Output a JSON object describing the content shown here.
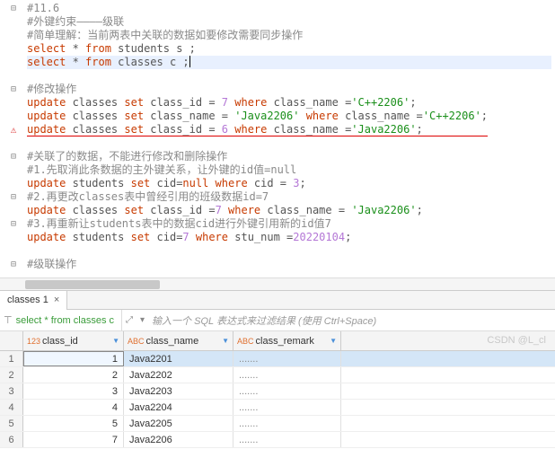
{
  "chart_data": {
    "type": "table",
    "title": "classes",
    "columns": [
      "class_id",
      "class_name",
      "class_remark"
    ],
    "rows": [
      [
        1,
        "Java2201",
        "......."
      ],
      [
        2,
        "Java2202",
        "......."
      ],
      [
        3,
        "Java2203",
        "......."
      ],
      [
        4,
        "Java2204",
        "......."
      ],
      [
        5,
        "Java2205",
        "......."
      ],
      [
        7,
        "Java2206",
        "......."
      ]
    ]
  },
  "code": {
    "l1": "#11.6",
    "l2": "#外键约束————级联",
    "l3": "#简单理解：当前两表中关联的数据如要修改需要同步操作",
    "l4a": "select",
    "l4b": " * ",
    "l4c": "from",
    "l4d": " students s ;",
    "l5a": "select",
    "l5b": " * ",
    "l5c": "from",
    "l5d": " classes c ;",
    "l7": "#修改操作",
    "l8a": "update",
    "l8b": " classes ",
    "l8c": "set",
    "l8d": " class_id = ",
    "l8e": "7",
    "l8f": " where",
    "l8g": " class_name =",
    "l8h": "'C++2206'",
    "l8i": ";",
    "l9a": "update",
    "l9b": " classes ",
    "l9c": "set",
    "l9d": " class_name = ",
    "l9e": "'Java2206'",
    "l9f": " where",
    "l9g": " class_name =",
    "l9h": "'C++2206'",
    "l9i": ";",
    "l10a": "update",
    "l10b": " classes ",
    "l10c": "set",
    "l10d": " class_id = ",
    "l10e": "6",
    "l10f": " where",
    "l10g": " class_name =",
    "l10h": "'Java2206'",
    "l10i": ";",
    "l12": "#关联了的数据，不能进行修改和删除操作",
    "l13": "#1.先取消此条数据的主外键关系，让外键的id值=null",
    "l14a": "update",
    "l14b": " students ",
    "l14c": "set",
    "l14d": " cid=",
    "l14e": "null",
    "l14f": " where",
    "l14g": " cid = ",
    "l14h": "3",
    "l14i": ";",
    "l15": "#2.再更改classes表中曾经引用的班级数据id=7",
    "l16a": "update",
    "l16b": " classes ",
    "l16c": "set",
    "l16d": " class_id =",
    "l16e": "7",
    "l16f": " where",
    "l16g": " class_name = ",
    "l16h": "'Java2206'",
    "l16i": ";",
    "l17": "#3.再重新让students表中的数据cid进行外键引用新的id值7",
    "l18a": "update",
    "l18b": " students ",
    "l18c": "set",
    "l18d": " cid=",
    "l18e": "7",
    "l18f": " where",
    "l18g": " stu_num =",
    "l18h": "20220104",
    "l18i": ";",
    "l20": "#级联操作"
  },
  "tab": {
    "label": "classes 1",
    "close": "×"
  },
  "filter": {
    "sql": "select * from classes c",
    "placeholder": "输入一个 SQL 表达式来过滤结果 (使用 Ctrl+Space)"
  },
  "grid": {
    "cols": {
      "c1": "class_id",
      "c2": "class_name",
      "c3": "class_remark",
      "t1": "123",
      "t2": "ABC",
      "t3": "ABC"
    },
    "rows": [
      {
        "n": "1",
        "id": "1",
        "name": "Java2201",
        "rem": "......."
      },
      {
        "n": "2",
        "id": "2",
        "name": "Java2202",
        "rem": "......."
      },
      {
        "n": "3",
        "id": "3",
        "name": "Java2203",
        "rem": "......."
      },
      {
        "n": "4",
        "id": "4",
        "name": "Java2204",
        "rem": "......."
      },
      {
        "n": "5",
        "id": "5",
        "name": "Java2205",
        "rem": "......."
      },
      {
        "n": "6",
        "id": "7",
        "name": "Java2206",
        "rem": "......."
      }
    ]
  },
  "watermark": "CSDN @L_cl"
}
